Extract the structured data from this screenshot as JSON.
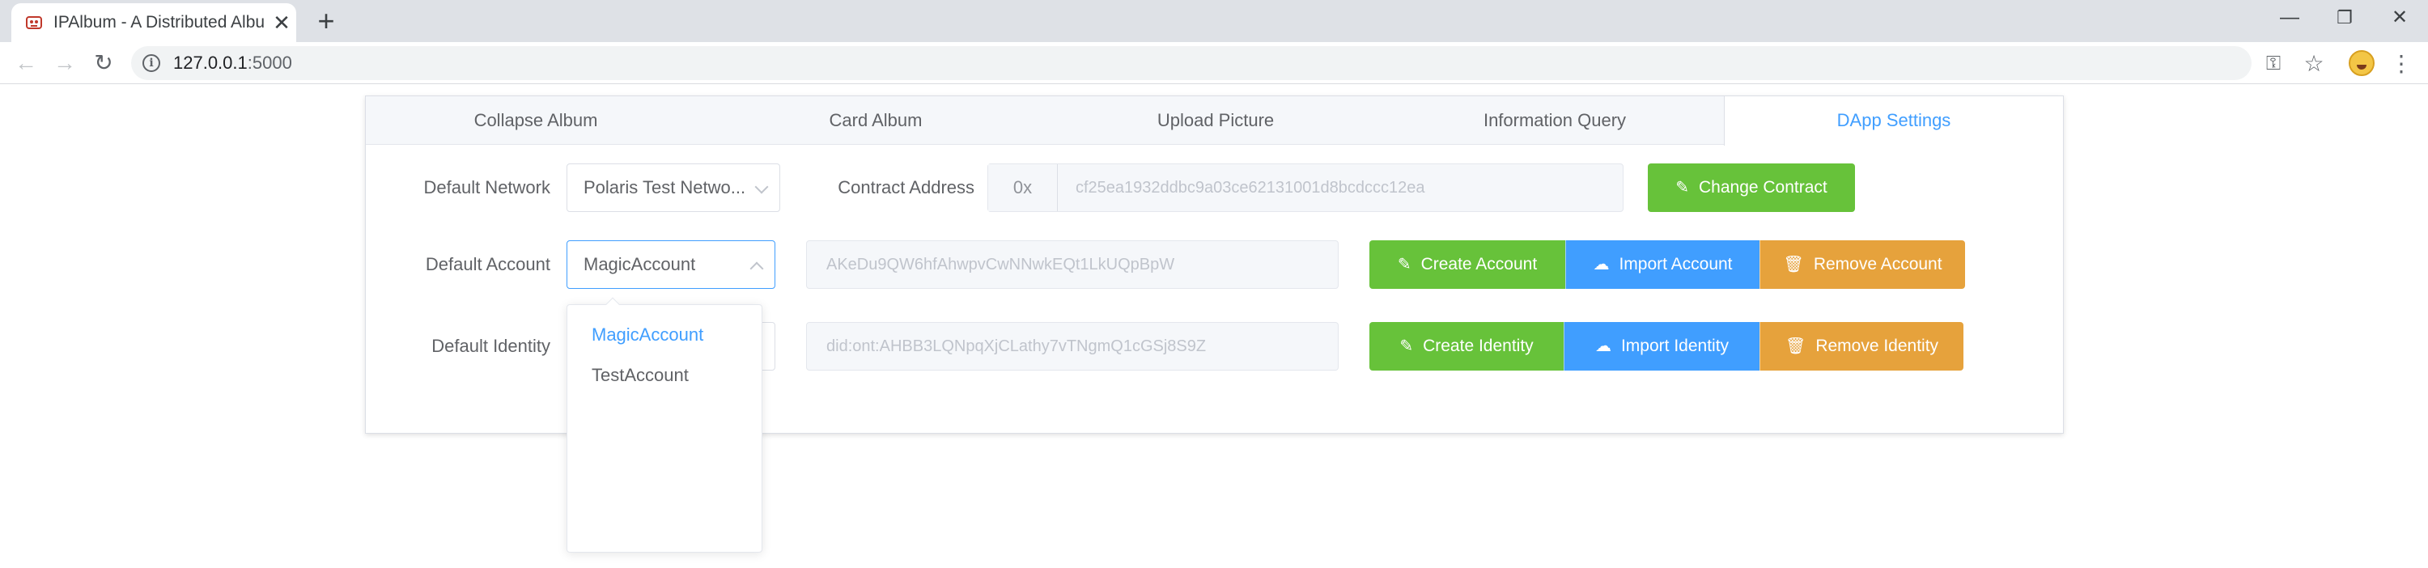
{
  "browser": {
    "tab_title": "IPAlbum - A Distributed Album",
    "tab_close": "✕",
    "new_tab": "+",
    "url_host": "127.0.0.1",
    "url_port": ":5000",
    "window_controls": {
      "minimize": "—",
      "restore": "❐",
      "close": "✕"
    },
    "icons": {
      "back": "back-arrow-icon",
      "forward": "forward-arrow-icon",
      "reload": "reload-icon",
      "info": "info-icon",
      "key": "key-icon",
      "star": "star-icon",
      "menu": "kebab-menu-icon"
    },
    "glyphs": {
      "back": "←",
      "forward": "→",
      "reload": "↻",
      "info": "i",
      "key": "⚿",
      "star": "☆",
      "menu": "⋮"
    }
  },
  "app": {
    "tabs": [
      {
        "label": "Collapse Album"
      },
      {
        "label": "Card Album"
      },
      {
        "label": "Upload Picture"
      },
      {
        "label": "Information Query"
      },
      {
        "label": "DApp Settings"
      }
    ],
    "active_tab": "DApp Settings",
    "network": {
      "label": "Default Network",
      "selected": "Polaris Test Netwo...",
      "contract_label": "Contract Address",
      "contract_prefix": "0x",
      "contract_value": "cf25ea1932ddbc9a03ce62131001d8bcdccc12ea",
      "change_contract": "Change Contract"
    },
    "account": {
      "label": "Default Account",
      "selected": "MagicAccount",
      "address": "AKeDu9QW6hfAhwpvCwNNwkEQt1LkUQpBpW",
      "create": "Create Account",
      "import": "Import Account",
      "remove": "Remove Account",
      "dropdown_options": [
        "MagicAccount",
        "TestAccount"
      ]
    },
    "identity": {
      "label": "Default Identity",
      "ontid": "did:ont:AHBB3LQNpqXjCLathy7vTNgmQ1cGSj8S9Z",
      "create": "Create Identity",
      "import": "Import Identity",
      "remove": "Remove Identity"
    },
    "colors": {
      "accent": "#409eff",
      "success": "#67c23a",
      "warning": "#e6a23c"
    }
  }
}
